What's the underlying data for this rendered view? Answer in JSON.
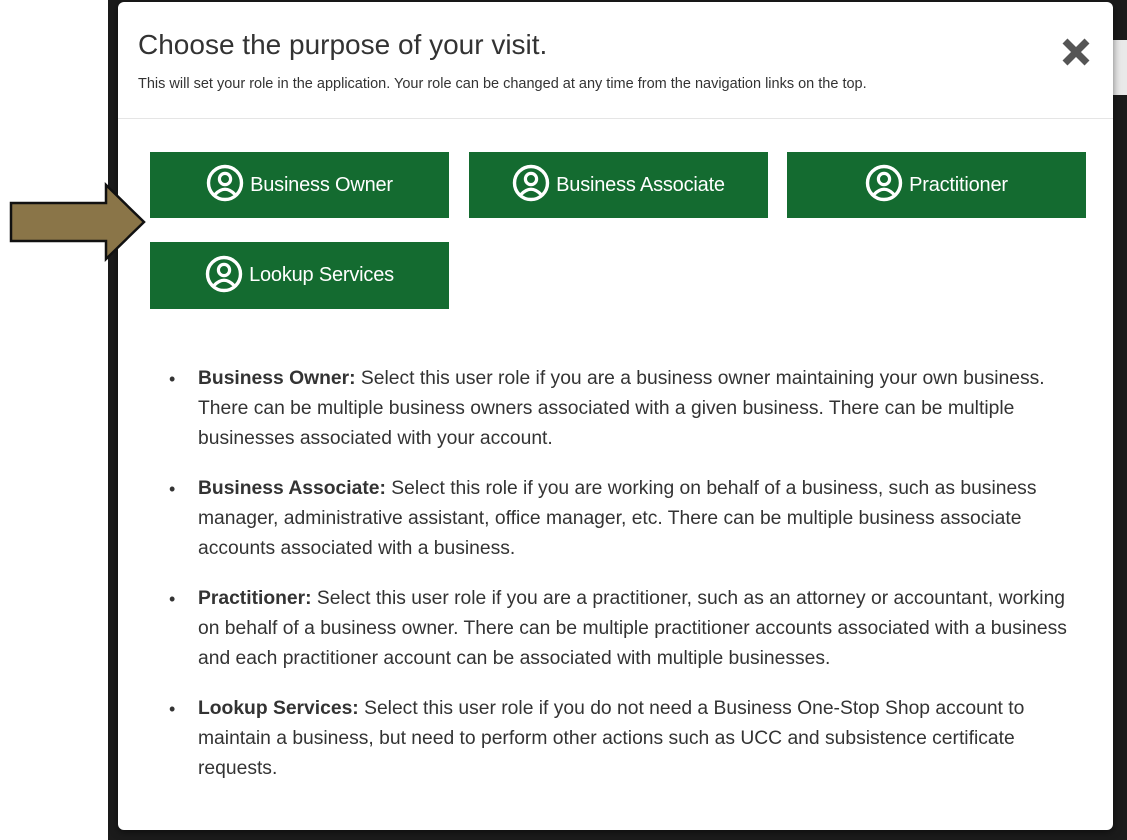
{
  "modal": {
    "title": "Choose the purpose of your visit.",
    "subtitle": "This will set your role in the application. Your role can be changed at any time from the navigation links on the top.",
    "close_icon": "close-x-icon"
  },
  "roles": [
    {
      "label": "Business Owner",
      "icon": "user-circle-icon"
    },
    {
      "label": "Business Associate",
      "icon": "user-circle-icon"
    },
    {
      "label": "Practitioner",
      "icon": "user-circle-icon"
    },
    {
      "label": "Lookup Services",
      "icon": "user-circle-icon"
    }
  ],
  "descriptions": [
    {
      "term": "Business Owner:",
      "text": " Select this user role if you are a business owner maintaining your own business. There can be multiple business owners associated with a given business. There can be multiple businesses associated with your account."
    },
    {
      "term": "Business Associate:",
      "text": " Select this role if you are working on behalf of a business, such as business manager, administrative assistant, office manager, etc. There can be multiple business associate accounts associated with a business."
    },
    {
      "term": "Practitioner:",
      "text": " Select this user role if you are a practitioner, such as an attorney or accountant, working on behalf of a business owner. There can be multiple practitioner accounts associated with a business and each practitioner account can be associated with multiple businesses."
    },
    {
      "term": "Lookup Services:",
      "text": " Select this user role if you do not need a Business One-Stop Shop account to maintain a business, but need to perform other actions such as UCC and subsistence certificate requests."
    }
  ],
  "colors": {
    "button_green": "#146b30",
    "arrow_fill": "#8a7548",
    "backdrop": "#1b1b1b"
  }
}
